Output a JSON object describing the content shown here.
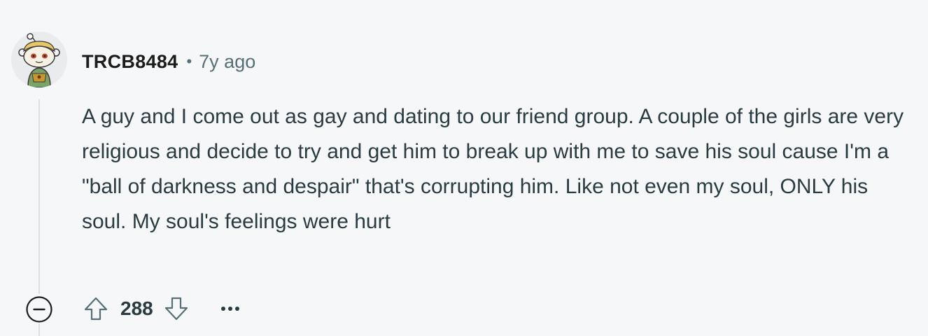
{
  "comment": {
    "username": "TRCB8484",
    "separator": "•",
    "timestamp": "7y ago",
    "body": "A guy and I come out as gay and dating to our friend group. A couple of the girls are very religious and decide to try and get him to break up with me to save his soul cause I'm a \"ball of darkness and despair\" that's corrupting him. Like not even my soul, ONLY his soul. My soul's feelings were hurt",
    "score": "288"
  },
  "icons": {
    "avatar": "snoo-avatar",
    "collapse": "minus-circle-icon",
    "upvote": "arrow-up-outline-icon",
    "downvote": "arrow-down-outline-icon",
    "more": "ellipsis-icon"
  },
  "colors": {
    "background": "#f6f7f8",
    "meta_text": "#576f76",
    "body_text": "#2a3c42",
    "thread_line": "#dde1e4"
  }
}
